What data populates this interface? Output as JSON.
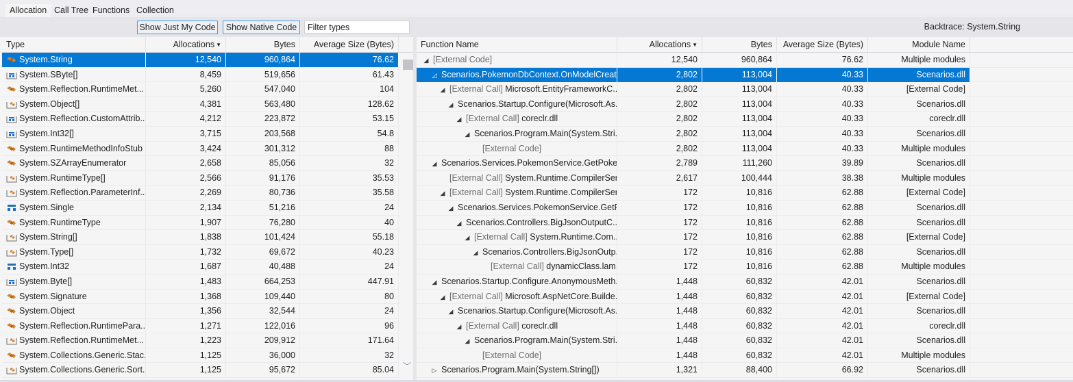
{
  "tabs": [
    {
      "label": "Allocation",
      "active": true
    },
    {
      "label": "Call Tree",
      "active": false
    },
    {
      "label": "Functions",
      "active": false
    },
    {
      "label": "Collection",
      "active": false
    }
  ],
  "toolbar": {
    "show_just_my_code": "Show Just My Code",
    "show_native_code": "Show Native Code",
    "filter_placeholder": "Filter types",
    "filter_value": ""
  },
  "backtrace_label": "Backtrace: System.String",
  "colors": {
    "selection": "#0478d2",
    "button_border": "#3d9ae6",
    "type_icon_orange": "#d9822b",
    "type_icon_blue": "#1e6fc1"
  },
  "types_table": {
    "columns": [
      "Type",
      "Allocations",
      "Bytes",
      "Average Size (Bytes)"
    ],
    "sort_column": "Allocations",
    "sort_direction": "descending",
    "rows": [
      {
        "icon": "class-icon",
        "type": "System.String",
        "allocations": "12,540",
        "bytes": "960,864",
        "avg": "76.62",
        "selected": true
      },
      {
        "icon": "array-struct-icon",
        "type": "System.SByte[]",
        "allocations": "8,459",
        "bytes": "519,656",
        "avg": "61.43"
      },
      {
        "icon": "class-icon",
        "type": "System.Reflection.RuntimeMet...",
        "allocations": "5,260",
        "bytes": "547,040",
        "avg": "104"
      },
      {
        "icon": "array-class-icon",
        "type": "System.Object[]",
        "allocations": "4,381",
        "bytes": "563,480",
        "avg": "128.62"
      },
      {
        "icon": "array-struct-icon",
        "type": "System.Reflection.CustomAttrib...",
        "allocations": "4,212",
        "bytes": "223,872",
        "avg": "53.15"
      },
      {
        "icon": "array-struct-icon",
        "type": "System.Int32[]",
        "allocations": "3,715",
        "bytes": "203,568",
        "avg": "54.8"
      },
      {
        "icon": "class-icon",
        "type": "System.RuntimeMethodInfoStub",
        "allocations": "3,424",
        "bytes": "301,312",
        "avg": "88"
      },
      {
        "icon": "class-icon",
        "type": "System.SZArrayEnumerator",
        "allocations": "2,658",
        "bytes": "85,056",
        "avg": "32"
      },
      {
        "icon": "array-class-icon",
        "type": "System.RuntimeType[]",
        "allocations": "2,566",
        "bytes": "91,176",
        "avg": "35.53"
      },
      {
        "icon": "array-class-icon",
        "type": "System.Reflection.ParameterInf...",
        "allocations": "2,269",
        "bytes": "80,736",
        "avg": "35.58"
      },
      {
        "icon": "struct-icon",
        "type": "System.Single",
        "allocations": "2,134",
        "bytes": "51,216",
        "avg": "24"
      },
      {
        "icon": "class-icon",
        "type": "System.RuntimeType",
        "allocations": "1,907",
        "bytes": "76,280",
        "avg": "40"
      },
      {
        "icon": "array-class-icon",
        "type": "System.String[]",
        "allocations": "1,838",
        "bytes": "101,424",
        "avg": "55.18"
      },
      {
        "icon": "array-class-icon",
        "type": "System.Type[]",
        "allocations": "1,732",
        "bytes": "69,672",
        "avg": "40.23"
      },
      {
        "icon": "struct-icon",
        "type": "System.Int32",
        "allocations": "1,687",
        "bytes": "40,488",
        "avg": "24"
      },
      {
        "icon": "array-struct-icon",
        "type": "System.Byte[]",
        "allocations": "1,483",
        "bytes": "664,253",
        "avg": "447.91"
      },
      {
        "icon": "class-icon",
        "type": "System.Signature",
        "allocations": "1,368",
        "bytes": "109,440",
        "avg": "80"
      },
      {
        "icon": "class-icon",
        "type": "System.Object",
        "allocations": "1,356",
        "bytes": "32,544",
        "avg": "24"
      },
      {
        "icon": "class-icon",
        "type": "System.Reflection.RuntimePara...",
        "allocations": "1,271",
        "bytes": "122,016",
        "avg": "96"
      },
      {
        "icon": "array-class-icon",
        "type": "System.Reflection.RuntimeMet...",
        "allocations": "1,223",
        "bytes": "209,912",
        "avg": "171.64"
      },
      {
        "icon": "class-icon",
        "type": "System.Collections.Generic.Stac...",
        "allocations": "1,125",
        "bytes": "36,000",
        "avg": "32"
      },
      {
        "icon": "array-class-icon",
        "type": "System.Collections.Generic.Sort...",
        "allocations": "1,125",
        "bytes": "95,672",
        "avg": "85.04"
      }
    ]
  },
  "backtrace_table": {
    "columns": [
      "Function Name",
      "Allocations",
      "Bytes",
      "Average Size (Bytes)",
      "Module Name"
    ],
    "sort_column": "Allocations",
    "sort_direction": "descending",
    "rows": [
      {
        "depth": 0,
        "toggle": "expanded",
        "prefix": "",
        "name": "[External Code]",
        "name_external": true,
        "allocations": "12,540",
        "bytes": "960,864",
        "avg": "76.62",
        "module": "Multiple modules"
      },
      {
        "depth": 1,
        "toggle": "expanded-outline",
        "prefix": "",
        "name": "Scenarios.PokemonDbContext.OnModelCreat...",
        "allocations": "2,802",
        "bytes": "113,004",
        "avg": "40.33",
        "module": "Scenarios.dll",
        "selected": true
      },
      {
        "depth": 2,
        "toggle": "expanded",
        "prefix": "[External Call]",
        "name": "Microsoft.EntityFrameworkC...",
        "allocations": "2,802",
        "bytes": "113,004",
        "avg": "40.33",
        "module": "[External Code]"
      },
      {
        "depth": 3,
        "toggle": "expanded",
        "prefix": "",
        "name": "Scenarios.Startup.Configure(Microsoft.As...",
        "allocations": "2,802",
        "bytes": "113,004",
        "avg": "40.33",
        "module": "Scenarios.dll"
      },
      {
        "depth": 4,
        "toggle": "expanded",
        "prefix": "[External Call]",
        "name": "coreclr.dll",
        "allocations": "2,802",
        "bytes": "113,004",
        "avg": "40.33",
        "module": "coreclr.dll"
      },
      {
        "depth": 5,
        "toggle": "expanded",
        "prefix": "",
        "name": "Scenarios.Program.Main(System.Stri...",
        "allocations": "2,802",
        "bytes": "113,004",
        "avg": "40.33",
        "module": "Scenarios.dll"
      },
      {
        "depth": 6,
        "toggle": "none",
        "prefix": "",
        "name": "[External Code]",
        "name_external": true,
        "allocations": "2,802",
        "bytes": "113,004",
        "avg": "40.33",
        "module": "Multiple modules"
      },
      {
        "depth": 1,
        "toggle": "expanded",
        "prefix": "",
        "name": "Scenarios.Services.PokemonService.GetPoke...",
        "allocations": "2,789",
        "bytes": "111,260",
        "avg": "39.89",
        "module": "Scenarios.dll"
      },
      {
        "depth": 2,
        "toggle": "none",
        "prefix": "[External Call]",
        "name": "System.Runtime.CompilerSer...",
        "allocations": "2,617",
        "bytes": "100,444",
        "avg": "38.38",
        "module": "Multiple modules"
      },
      {
        "depth": 2,
        "toggle": "expanded",
        "prefix": "[External Call]",
        "name": "System.Runtime.CompilerSer...",
        "allocations": "172",
        "bytes": "10,816",
        "avg": "62.88",
        "module": "[External Code]"
      },
      {
        "depth": 3,
        "toggle": "expanded",
        "prefix": "",
        "name": "Scenarios.Services.PokemonService.GetP...",
        "allocations": "172",
        "bytes": "10,816",
        "avg": "62.88",
        "module": "Scenarios.dll"
      },
      {
        "depth": 4,
        "toggle": "expanded",
        "prefix": "",
        "name": "Scenarios.Controllers.BigJsonOutputC...",
        "allocations": "172",
        "bytes": "10,816",
        "avg": "62.88",
        "module": "Scenarios.dll"
      },
      {
        "depth": 5,
        "toggle": "expanded",
        "prefix": "[External Call]",
        "name": "System.Runtime.Com...",
        "allocations": "172",
        "bytes": "10,816",
        "avg": "62.88",
        "module": "[External Code]"
      },
      {
        "depth": 6,
        "toggle": "expanded",
        "prefix": "",
        "name": "Scenarios.Controllers.BigJsonOutp...",
        "allocations": "172",
        "bytes": "10,816",
        "avg": "62.88",
        "module": "Scenarios.dll"
      },
      {
        "depth": 7,
        "toggle": "none",
        "prefix": "[External Call]",
        "name": "dynamicClass.lam...",
        "allocations": "172",
        "bytes": "10,816",
        "avg": "62.88",
        "module": "Multiple modules"
      },
      {
        "depth": 1,
        "toggle": "expanded",
        "prefix": "",
        "name": "Scenarios.Startup.Configure.AnonymousMeth...",
        "allocations": "1,448",
        "bytes": "60,832",
        "avg": "42.01",
        "module": "Scenarios.dll"
      },
      {
        "depth": 2,
        "toggle": "expanded",
        "prefix": "[External Call]",
        "name": "Microsoft.AspNetCore.Builde...",
        "allocations": "1,448",
        "bytes": "60,832",
        "avg": "42.01",
        "module": "[External Code]"
      },
      {
        "depth": 3,
        "toggle": "expanded",
        "prefix": "",
        "name": "Scenarios.Startup.Configure(Microsoft.As...",
        "allocations": "1,448",
        "bytes": "60,832",
        "avg": "42.01",
        "module": "Scenarios.dll"
      },
      {
        "depth": 4,
        "toggle": "expanded",
        "prefix": "[External Call]",
        "name": "coreclr.dll",
        "allocations": "1,448",
        "bytes": "60,832",
        "avg": "42.01",
        "module": "coreclr.dll"
      },
      {
        "depth": 5,
        "toggle": "expanded",
        "prefix": "",
        "name": "Scenarios.Program.Main(System.Stri...",
        "allocations": "1,448",
        "bytes": "60,832",
        "avg": "42.01",
        "module": "Scenarios.dll"
      },
      {
        "depth": 6,
        "toggle": "none",
        "prefix": "",
        "name": "[External Code]",
        "name_external": true,
        "allocations": "1,448",
        "bytes": "60,832",
        "avg": "42.01",
        "module": "Multiple modules"
      },
      {
        "depth": 1,
        "toggle": "collapsed",
        "prefix": "",
        "name": "Scenarios.Program.Main(System.String[])",
        "allocations": "1,321",
        "bytes": "88,400",
        "avg": "66.92",
        "module": "Scenarios.dll"
      }
    ]
  }
}
